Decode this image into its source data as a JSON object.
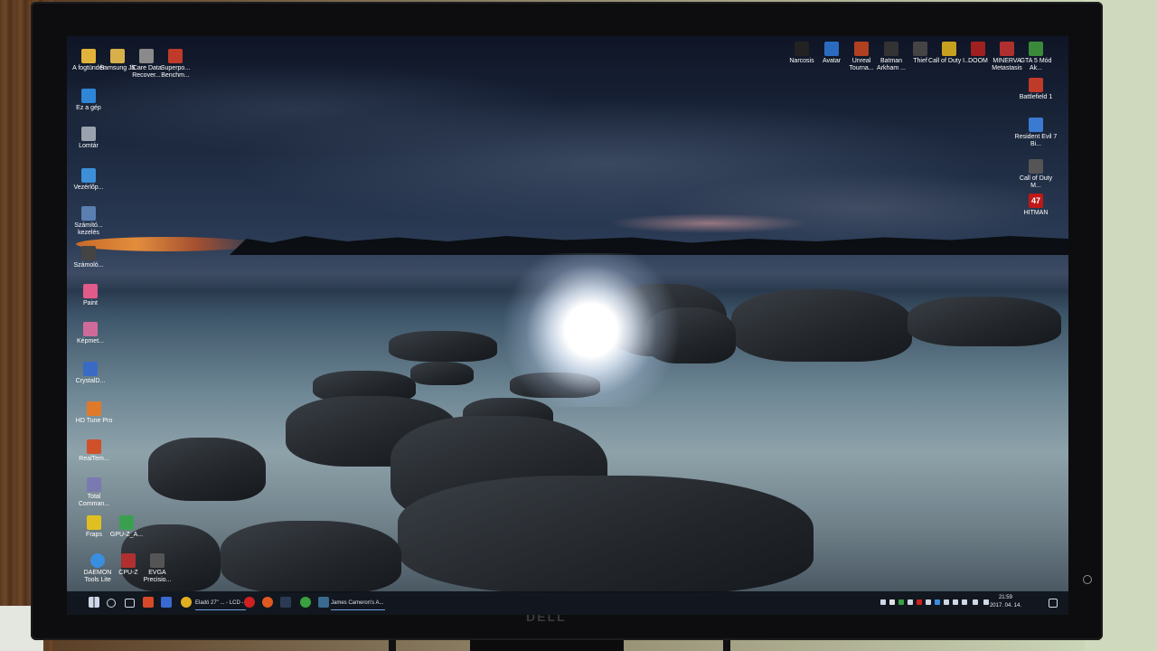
{
  "brand": "DELL",
  "desktop_icons_left": [
    {
      "label": "A fogtündér",
      "icon": "folder-icon",
      "color": "#e2b33a"
    },
    {
      "label": "Samsung J5",
      "icon": "phone-icon",
      "color": "#d8b04a"
    },
    {
      "label": "iCare Data Recover...",
      "icon": "recovery-icon",
      "color": "#8a8a8a"
    },
    {
      "label": "Superpo... Benchm...",
      "icon": "benchmark-icon",
      "color": "#c03a2a"
    },
    {
      "label": "Ez a gép",
      "icon": "computer-icon",
      "color": "#2f86d6"
    },
    {
      "label": "Lomtár",
      "icon": "recycle-bin-icon",
      "color": "#9aa3ad"
    },
    {
      "label": "Vezérlőp...",
      "icon": "control-panel-icon",
      "color": "#3c8fd8"
    },
    {
      "label": "Számító... kezelés",
      "icon": "computer-management-icon",
      "color": "#5a7fb0"
    },
    {
      "label": "Számoló...",
      "icon": "calculator-icon",
      "color": "#444"
    },
    {
      "label": "Paint",
      "icon": "paint-icon",
      "color": "#e05a8a"
    },
    {
      "label": "Képmet...",
      "icon": "image-icon",
      "color": "#d06a9a"
    },
    {
      "label": "CrystalD...",
      "icon": "crystaldisk-icon",
      "color": "#3a6bc4"
    },
    {
      "label": "HD Tune Pro",
      "icon": "hdtune-icon",
      "color": "#e07a2a"
    },
    {
      "label": "RealTem...",
      "icon": "realtemp-icon",
      "color": "#d0502a"
    },
    {
      "label": "Total Comman...",
      "icon": "total-commander-icon",
      "color": "#d8d8e8"
    },
    {
      "label": "Fraps",
      "icon": "fraps-icon",
      "color": "#e0c020"
    },
    {
      "label": "GPU-Z_A...",
      "icon": "gpuz-icon",
      "color": "#3aa050"
    },
    {
      "label": "DAEMON Tools Lite",
      "icon": "daemon-tools-icon",
      "color": "#3a8ee0"
    },
    {
      "label": "CPU-Z",
      "icon": "cpuz-icon",
      "color": "#b03030"
    },
    {
      "label": "EVGA Precisio...",
      "icon": "evga-icon",
      "color": "#555"
    }
  ],
  "desktop_icons_right": [
    {
      "label": "Narcosis",
      "icon": "narcosis-icon",
      "color": "#222"
    },
    {
      "label": "Avatar",
      "icon": "avatar-icon",
      "color": "#2a6bc0"
    },
    {
      "label": "Unreal Tourna...",
      "icon": "unreal-icon",
      "color": "#b04020"
    },
    {
      "label": "Batman Arkham ...",
      "icon": "batman-icon",
      "color": "#333"
    },
    {
      "label": "Thief",
      "icon": "thief-icon",
      "color": "#444"
    },
    {
      "label": "Call of Duty I...",
      "icon": "cod-icon",
      "color": "#c8a020"
    },
    {
      "label": "DOOM",
      "icon": "doom-icon",
      "color": "#a02020"
    },
    {
      "label": "MINERVA Metastasis",
      "icon": "minerva-icon",
      "color": "#b03030"
    },
    {
      "label": "GTA 5 Mód Ak...",
      "icon": "gta-icon",
      "color": "#3a8a3a"
    },
    {
      "label": "Battlefield 1",
      "icon": "battlefield-icon",
      "color": "#c03a2a"
    },
    {
      "label": "Resident Evil 7 Bi...",
      "icon": "resident-evil-icon",
      "color": "#3a7ad0"
    },
    {
      "label": "Call of Duty M...",
      "icon": "cod-mw-icon",
      "color": "#555"
    },
    {
      "label": "HITMAN",
      "icon": "hitman-icon",
      "color": "#c01818",
      "glyph": "47"
    }
  ],
  "taskbar": {
    "windows_tasks": [
      {
        "label": "Eladó 27\" ... - LCD - ..."
      },
      {
        "label": "James Cameron's A..."
      }
    ],
    "clock_time": "21:59",
    "clock_date": "2017. 04. 14."
  }
}
